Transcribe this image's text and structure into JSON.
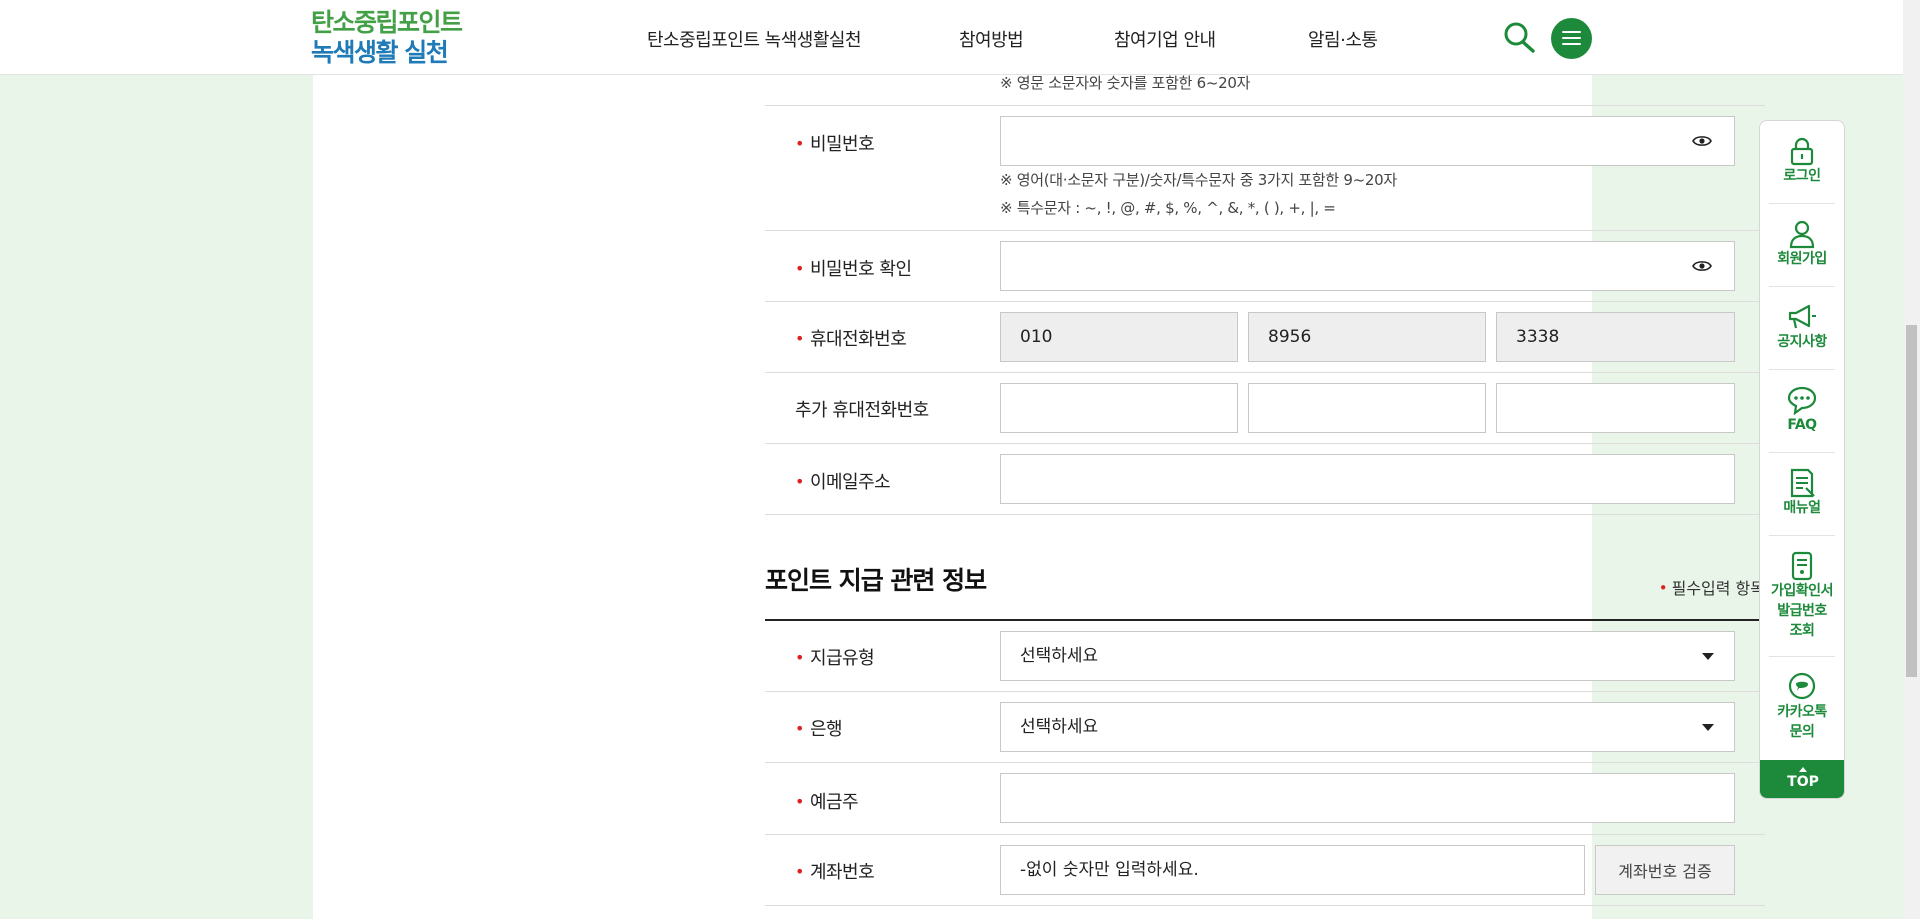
{
  "header": {
    "logo_line1": "탄소중립포인트",
    "logo_line2": "녹색생활 실천",
    "nav": [
      {
        "label": "탄소중립포인트 녹색생활실천"
      },
      {
        "label": "참여방법"
      },
      {
        "label": "참여기업 안내"
      },
      {
        "label": "알림·소통"
      }
    ]
  },
  "form": {
    "id_note": "※ 영문 소문자와 숫자를 포함한 6~20자",
    "password": {
      "label": "비밀번호",
      "value": "",
      "note1": "※ 영어(대·소문자 구분)/숫자/특수문자 중 3가지 포함한 9~20자",
      "note2": "※ 특수문자 : ~, !, @, #, $, %, ^, &, *, ( ), +, |, ="
    },
    "password_confirm": {
      "label": "비밀번호 확인",
      "value": ""
    },
    "mobile": {
      "label": "휴대전화번호",
      "part1": "010",
      "part2": "8956",
      "part3": "3338"
    },
    "extra_mobile": {
      "label": "추가 휴대전화번호",
      "part1": "",
      "part2": "",
      "part3": ""
    },
    "email": {
      "label": "이메일주소",
      "value": ""
    },
    "required_mark": "•"
  },
  "payment": {
    "section_title": "포인트 지급 관련 정보",
    "required_note": "필수입력 항목",
    "pay_type": {
      "label": "지급유형",
      "selected": "선택하세요"
    },
    "bank": {
      "label": "은행",
      "selected": "선택하세요"
    },
    "depositor": {
      "label": "예금주",
      "value": ""
    },
    "account": {
      "label": "계좌번호",
      "placeholder": "-없이 숫자만 입력하세요.",
      "verify_button": "계좌번호 검증"
    }
  },
  "quick_menu": {
    "items": [
      {
        "label": "로그인",
        "icon": "lock-icon"
      },
      {
        "label": "회원가입",
        "icon": "person-icon"
      },
      {
        "label": "공지사항",
        "icon": "megaphone-icon"
      },
      {
        "label": "FAQ",
        "icon": "chat-bubble-icon"
      },
      {
        "label": "매뉴얼",
        "icon": "document-icon"
      },
      {
        "label": "가입확인서\n발급번호\n조회",
        "lines": [
          "가입확인서",
          "발급번호",
          "조회"
        ],
        "icon": "certificate-icon"
      },
      {
        "label": "카카오톡\n문의",
        "lines": [
          "카카오톡",
          "문의"
        ],
        "icon": "kakao-talk-icon"
      }
    ],
    "top_label": "TOP"
  },
  "colors": {
    "brand_green": "#1c8a3a",
    "logo_green": "#43a047",
    "logo_blue": "#1e7bb8",
    "required_red": "#dd2222",
    "page_bg": "#eaf5ea"
  }
}
